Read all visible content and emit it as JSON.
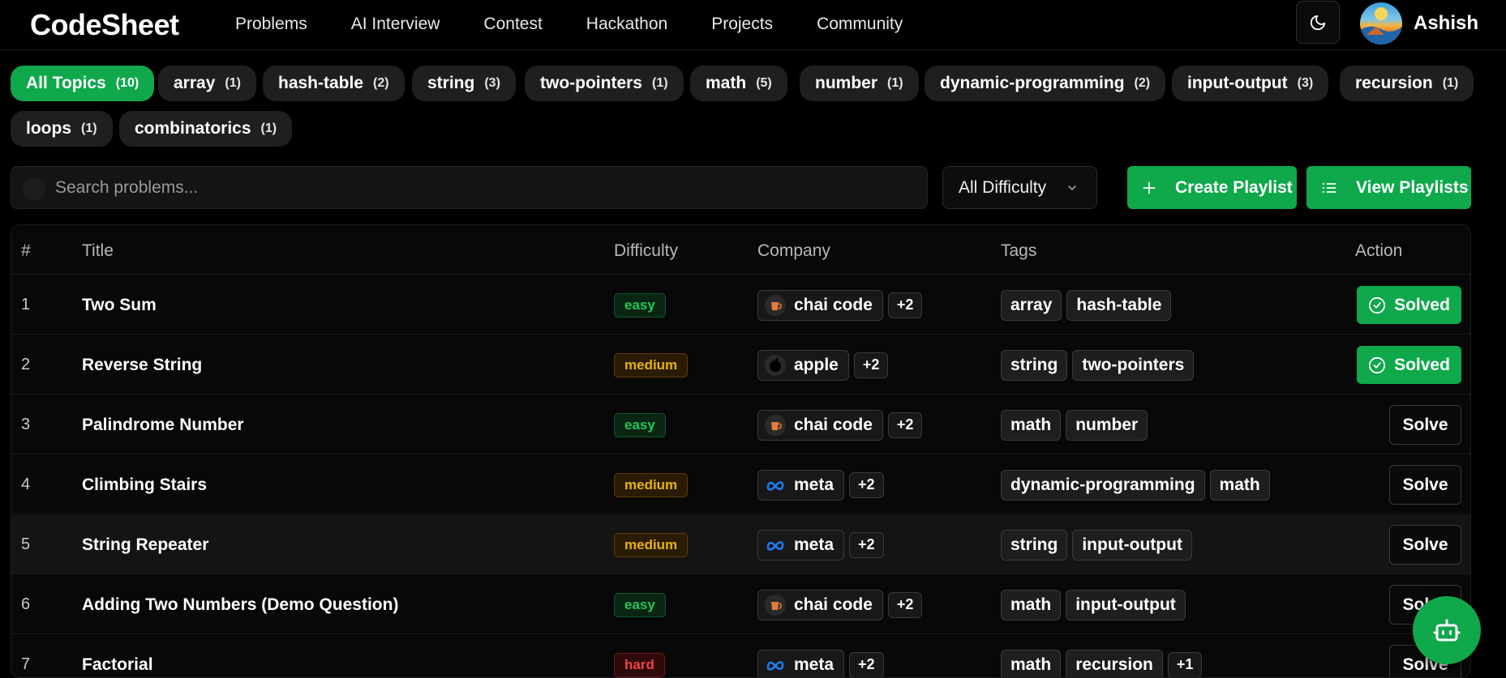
{
  "app": {
    "logo": "CodeSheet"
  },
  "nav": {
    "links": [
      "Problems",
      "AI Interview",
      "Contest",
      "Hackathon",
      "Projects",
      "Community"
    ],
    "user_name": "Ashish"
  },
  "topics": [
    {
      "label": "All Topics",
      "count": "(10)",
      "active": true
    },
    {
      "label": "array",
      "count": "(1)"
    },
    {
      "label": "hash-table",
      "count": "(2)"
    },
    {
      "label": "string",
      "count": "(3)"
    },
    {
      "label": "two-pointers",
      "count": "(1)"
    },
    {
      "label": "math",
      "count": "(5)"
    },
    {
      "label": "number",
      "count": "(1)"
    },
    {
      "label": "dynamic-programming",
      "count": "(2)"
    },
    {
      "label": "input-output",
      "count": "(3)"
    },
    {
      "label": "recursion",
      "count": "(1)"
    },
    {
      "label": "loops",
      "count": "(1)"
    },
    {
      "label": "combinatorics",
      "count": "(1)"
    }
  ],
  "search": {
    "placeholder": "Search problems..."
  },
  "filter": {
    "difficulty_selected": "All Difficulty"
  },
  "actions": {
    "create_playlist": "Create Playlist",
    "view_playlists": "View Playlists"
  },
  "table": {
    "headers": {
      "num": "#",
      "title": "Title",
      "difficulty": "Difficulty",
      "company": "Company",
      "tags": "Tags",
      "action": "Action"
    },
    "rows": [
      {
        "num": "1",
        "title": "Two Sum",
        "difficulty": "easy",
        "company": "chai code",
        "company_icon": "chai-code-logo-icon",
        "company_more": "+2",
        "tags": [
          "array",
          "hash-table"
        ],
        "tags_more": "",
        "action": "Solved",
        "solved": true
      },
      {
        "num": "2",
        "title": "Reverse String",
        "difficulty": "medium",
        "company": "apple",
        "company_icon": "apple-logo-icon",
        "company_more": "+2",
        "tags": [
          "string",
          "two-pointers"
        ],
        "tags_more": "",
        "action": "Solved",
        "solved": true
      },
      {
        "num": "3",
        "title": "Palindrome Number",
        "difficulty": "easy",
        "company": "chai code",
        "company_icon": "chai-code-logo-icon",
        "company_more": "+2",
        "tags": [
          "math",
          "number"
        ],
        "tags_more": "",
        "action": "Solve",
        "solved": false
      },
      {
        "num": "4",
        "title": "Climbing Stairs",
        "difficulty": "medium",
        "company": "meta",
        "company_icon": "meta-logo-icon",
        "company_more": "+2",
        "tags": [
          "dynamic-programming",
          "math"
        ],
        "tags_more": "",
        "action": "Solve",
        "solved": false
      },
      {
        "num": "5",
        "title": "String Repeater",
        "difficulty": "medium",
        "company": "meta",
        "company_icon": "meta-logo-icon",
        "company_more": "+2",
        "tags": [
          "string",
          "input-output"
        ],
        "tags_more": "",
        "action": "Solve",
        "solved": false,
        "highlighted": true
      },
      {
        "num": "6",
        "title": "Adding Two Numbers (Demo Question)",
        "difficulty": "easy",
        "company": "chai code",
        "company_icon": "chai-code-logo-icon",
        "company_more": "+2",
        "tags": [
          "math",
          "input-output"
        ],
        "tags_more": "",
        "action": "Solve",
        "solved": false
      },
      {
        "num": "7",
        "title": "Factorial",
        "difficulty": "hard",
        "company": "meta",
        "company_icon": "meta-logo-icon",
        "company_more": "+2",
        "tags": [
          "math",
          "recursion"
        ],
        "tags_more": "+1",
        "action": "Solve",
        "solved": false
      }
    ]
  },
  "colors": {
    "accent": "#0fa84b",
    "easy": "#22c55e",
    "medium": "#eab308",
    "hard": "#ef4444"
  }
}
